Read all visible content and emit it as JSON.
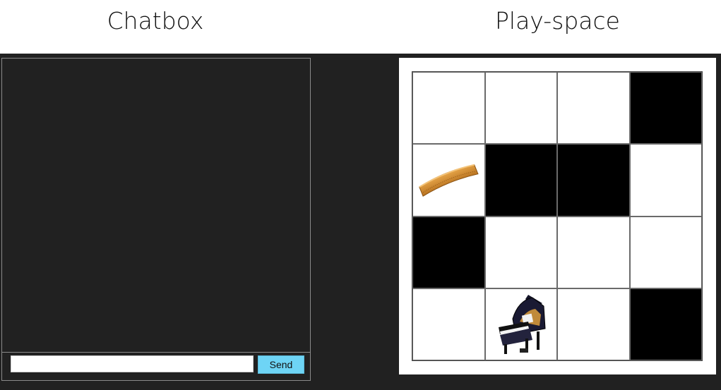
{
  "headings": {
    "chatbox": "Chatbox",
    "playspace": "Play-space"
  },
  "chat": {
    "input_value": "",
    "send_label": "Send"
  },
  "board": {
    "rows": 4,
    "cols": 4,
    "cells": [
      [
        "white",
        "white",
        "white",
        "black"
      ],
      [
        "comb-icon",
        "black",
        "black",
        "white"
      ],
      [
        "black",
        "white",
        "white",
        "white"
      ],
      [
        "white",
        "piano-icon",
        "white",
        "black"
      ]
    ]
  },
  "colors": {
    "background": "#212121",
    "send_button": "#6ed4f5",
    "dark_cell": "#000000",
    "light_cell": "#ffffff"
  }
}
